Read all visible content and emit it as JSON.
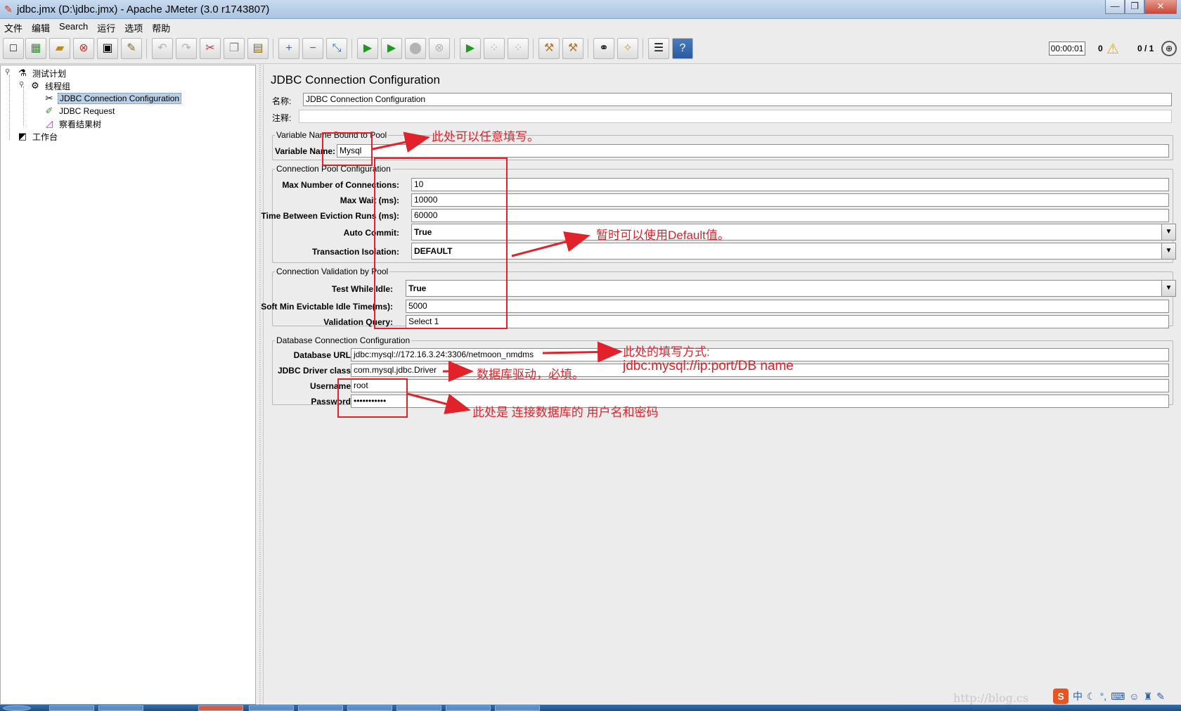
{
  "window": {
    "title": "jdbc.jmx (D:\\jdbc.jmx) - Apache JMeter (3.0 r1743807)",
    "minimize": "—",
    "maximize": "❐",
    "close": "✕"
  },
  "menu": [
    "文件",
    "编辑",
    "Search",
    "运行",
    "选项",
    "帮助"
  ],
  "toolbar": {
    "icons": [
      "new-icon",
      "templates-icon",
      "open-icon",
      "close-icon",
      "save-icon",
      "save-as-icon",
      "undo-icon",
      "redo-icon",
      "cut-icon",
      "copy-icon",
      "paste-icon",
      "expand-icon",
      "collapse-icon",
      "toggle-icon",
      "start-icon",
      "start-no-timers-icon",
      "stop-icon",
      "shutdown-icon",
      "remote-start-icon",
      "remote-stop-icon",
      "remote-exit-icon",
      "clear-icon",
      "clear-all-icon",
      "search-icon",
      "reset-search-icon",
      "function-helper-icon",
      "help-icon"
    ],
    "timer": "00:00:01",
    "error_count": "0",
    "thread_count": "0 / 1"
  },
  "tree": {
    "test_plan": "测试计划",
    "thread_group": "线程组",
    "jdbc_config": "JDBC Connection Configuration",
    "jdbc_request": "JDBC Request",
    "results_tree": "察看结果树",
    "workbench": "工作台"
  },
  "panel": {
    "title": "JDBC Connection Configuration",
    "name_label": "名称:",
    "name_value": "JDBC Connection Configuration",
    "comment_label": "注释:",
    "comment_value": "",
    "var_group": {
      "title": "Variable Name Bound to Pool",
      "var_label": "Variable Name:",
      "var_value": "Mysql"
    },
    "pool_group": {
      "title": "Connection Pool Configuration",
      "max_conn_label": "Max Number of Connections:",
      "max_conn_value": "10",
      "max_wait_label": "Max Wait (ms):",
      "max_wait_value": "10000",
      "eviction_label": "Time Between Eviction Runs (ms):",
      "eviction_value": "60000",
      "auto_commit_label": "Auto Commit:",
      "auto_commit_value": "True",
      "isolation_label": "Transaction Isolation:",
      "isolation_value": "DEFAULT"
    },
    "validation_group": {
      "title": "Connection Validation by Pool",
      "test_idle_label": "Test While Idle:",
      "test_idle_value": "True",
      "soft_min_label": "Soft Min Evictable Idle Time(ms):",
      "soft_min_value": "5000",
      "query_label": "Validation Query:",
      "query_value": "Select 1"
    },
    "db_group": {
      "title": "Database Connection Configuration",
      "url_label": "Database URL:",
      "url_value": "jdbc:mysql://172.16.3.24:3306/netmoon_nmdms",
      "driver_label": "JDBC Driver class:",
      "driver_value": "com.mysql.jdbc.Driver",
      "user_label": "Username:",
      "user_value": "root",
      "pass_label": "Password:",
      "pass_value": "•••••••••••"
    }
  },
  "annotations": {
    "var_note": "此处可以任意填写。",
    "default_note": "暂时可以使用Default值。",
    "url_note_1": "此处的填写方式:",
    "url_note_2": "jdbc:mysql://ip:port/DB name",
    "driver_note": "数据库驱动，必填。",
    "cred_note": "此处是 连接数据库的 用户名和密码",
    "color": "#e2222a"
  },
  "watermark": "http://blog.cs",
  "ime": {
    "logo": "S",
    "mode": "中"
  }
}
